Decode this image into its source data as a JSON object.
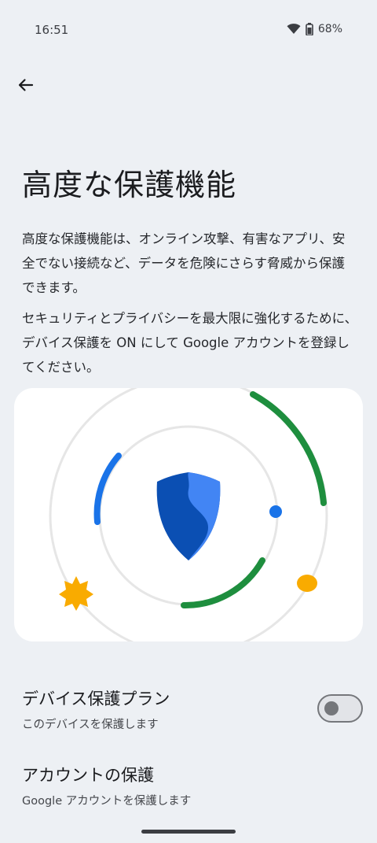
{
  "status_bar": {
    "time": "16:51",
    "battery": "68%",
    "icons": [
      "wifi-icon",
      "battery-icon"
    ]
  },
  "header": {
    "back_icon": "arrow-back-icon",
    "title": "高度な保護機能"
  },
  "main": {
    "description": "高度な保護機能は、オンライン攻撃、有害なアプリ、安全でない接続など、データを危険にさらす脅威から保護できます。",
    "description_2": " セキュリティとプライバシーを最大限に強化するために、デバイス保護を ON にして Google アカウントを登録してください。",
    "illustration": "shield-icon"
  },
  "settings": {
    "device_protection": {
      "title": "デバイス保護プラン",
      "subtitle": "このデバイスを保護します",
      "enabled": false
    },
    "account_protection": {
      "title": "アカウントの保護",
      "subtitle": "Google アカウントを保護します"
    }
  },
  "colors": {
    "background": "#edf0f4",
    "card": "#ffffff",
    "blue": "#1a73e8",
    "green": "#1e8e3e",
    "yellow": "#f9ab00",
    "shield_dark": "#0b4fb3",
    "shield_light": "#4285f4"
  }
}
